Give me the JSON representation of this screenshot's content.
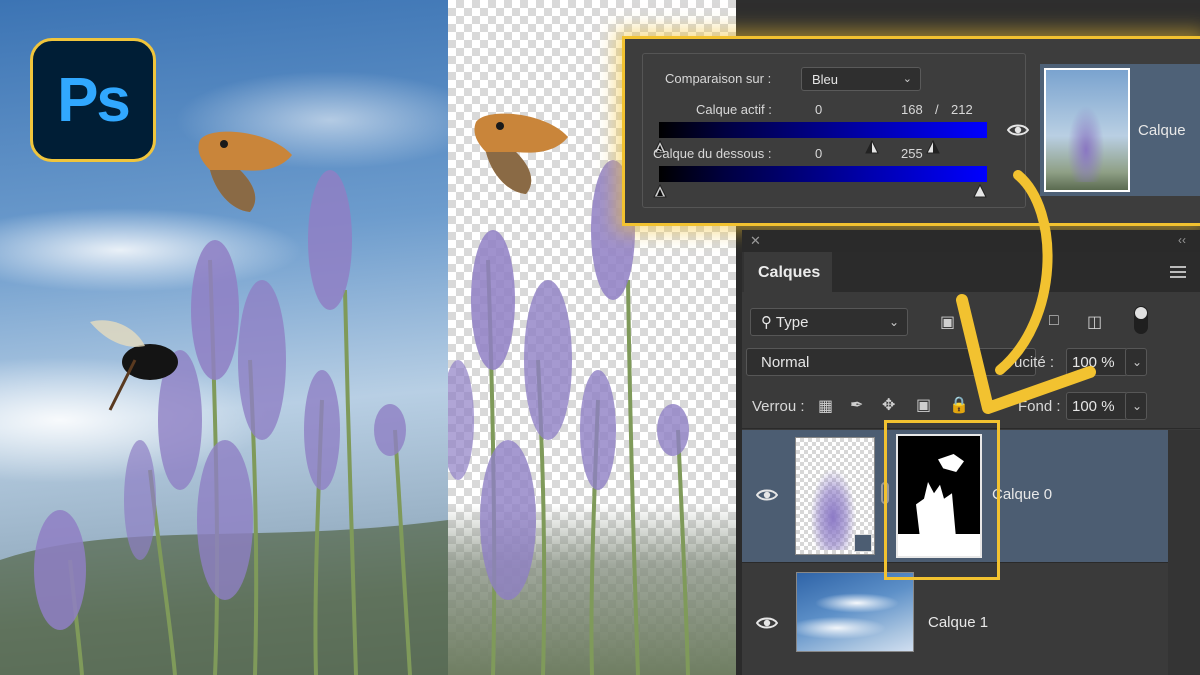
{
  "logo": {
    "text": "Ps"
  },
  "blend_if": {
    "compare_label": "Comparaison sur :",
    "channel_value": "Bleu",
    "channel_icon": "chevron-down-icon",
    "this_layer": {
      "label": "Calque actif :",
      "low": "0",
      "high_split": "168",
      "slash": "/",
      "high": "212"
    },
    "underlying_layer": {
      "label": "Calque du dessous :",
      "low": "0",
      "high": "255"
    },
    "preview_layer_name": "Calque"
  },
  "layers_panel": {
    "tab_label": "Calques",
    "filter": {
      "value": "Type",
      "icon": "search-icon"
    },
    "blend_mode": "Normal",
    "opacity": {
      "label": "ucité :",
      "value": "100 %"
    },
    "lock": {
      "label": "Verrou :"
    },
    "fill": {
      "label": "Fond :",
      "value": "100 %"
    },
    "layers": [
      {
        "name": "Calque 0",
        "selected": true,
        "has_mask": true
      },
      {
        "name": "Calque 1",
        "selected": false,
        "has_mask": false
      }
    ]
  },
  "colors": {
    "highlight": "#f2c230",
    "ps_blue": "#31a8ff",
    "ps_bg": "#001e36",
    "selected_row": "#4c5d72"
  }
}
